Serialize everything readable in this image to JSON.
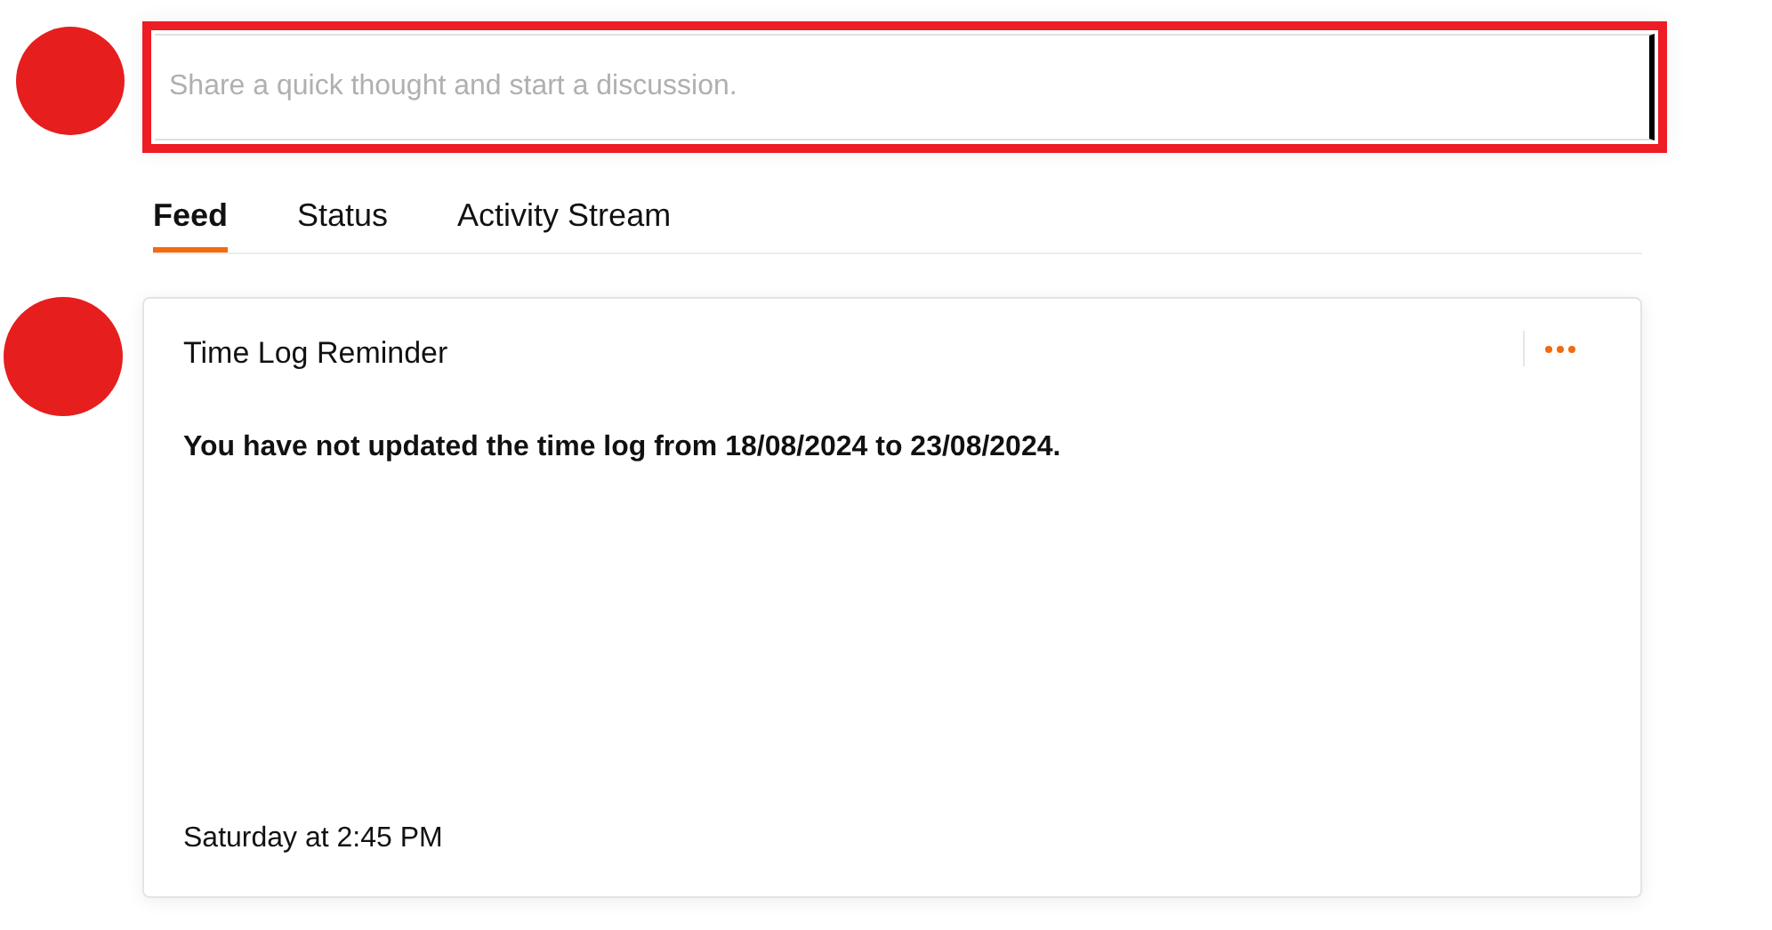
{
  "composer": {
    "placeholder": "Share a quick thought and start a discussion."
  },
  "tabs": [
    {
      "label": "Feed",
      "selected": true
    },
    {
      "label": "Status",
      "selected": false
    },
    {
      "label": "Activity Stream",
      "selected": false
    }
  ],
  "posts": [
    {
      "title": "Time Log Reminder",
      "body": "You have not updated the time log from 18/08/2024 to 23/08/2024.",
      "time": "Saturday at 2:45 PM"
    }
  ]
}
